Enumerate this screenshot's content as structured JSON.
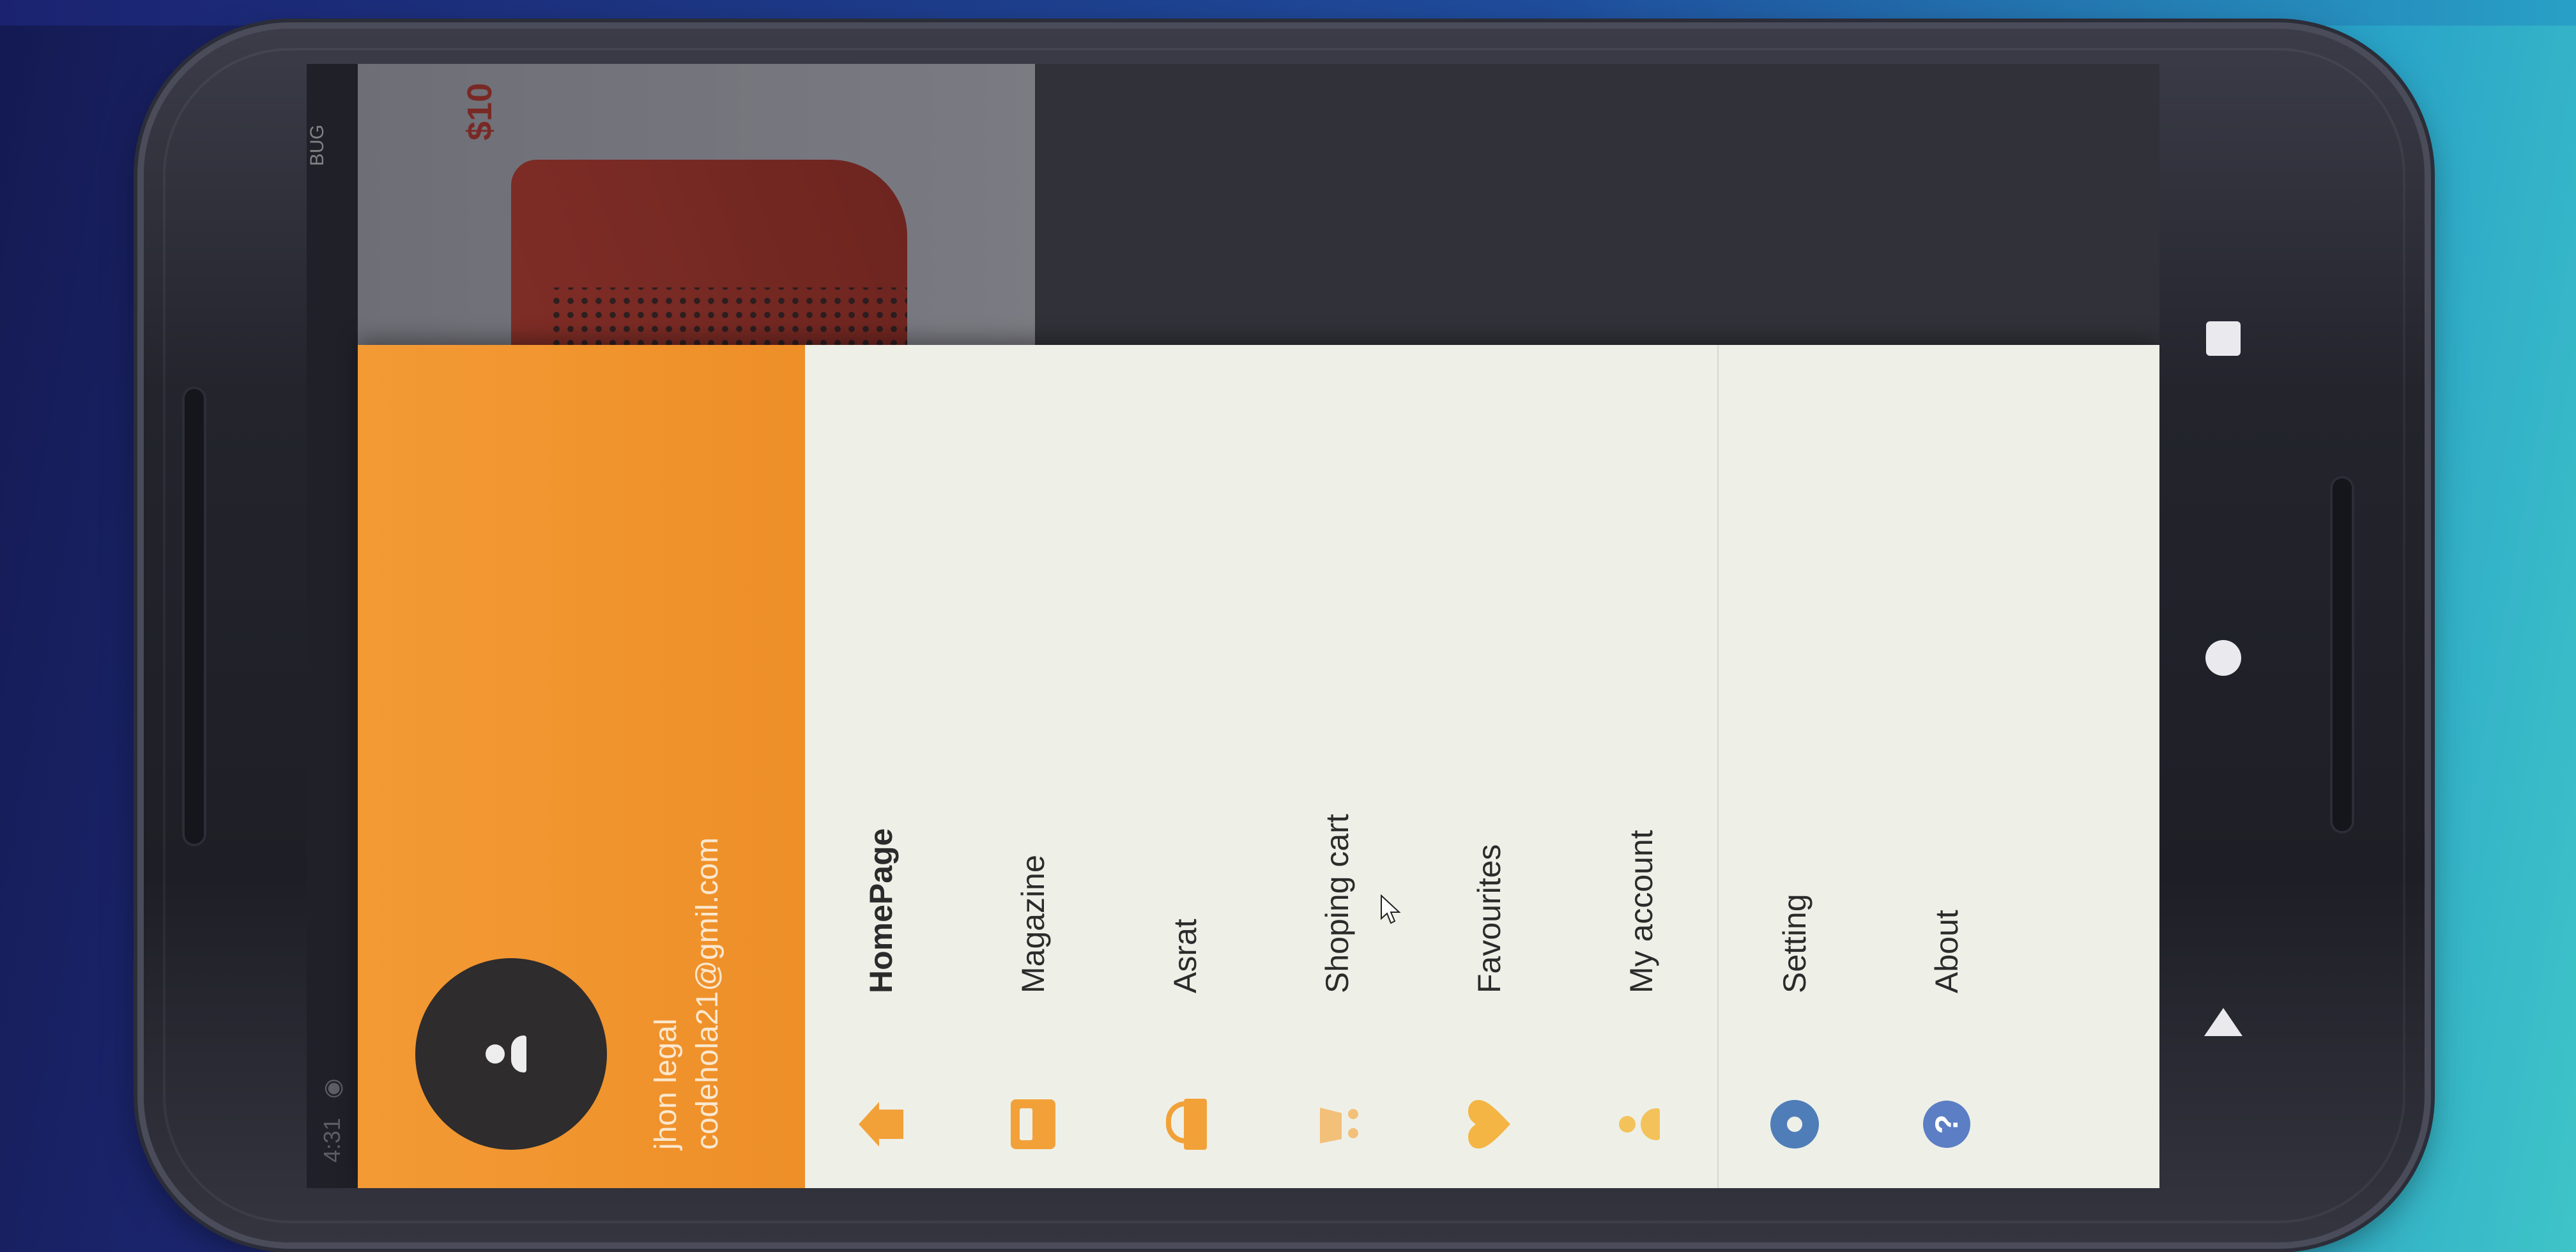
{
  "status_bar": {
    "time": "4:31"
  },
  "debug_badge": "BUG",
  "product": {
    "price": "$10"
  },
  "drawer": {
    "user_name": "jhon legal",
    "user_email": "codehola21@gmil.com",
    "items": [
      {
        "label": "HomePage",
        "icon": "home-icon",
        "active": true
      },
      {
        "label": "Magazine",
        "icon": "magazine-icon"
      },
      {
        "label": "Asrat",
        "icon": "basket-icon"
      },
      {
        "label": "Shoping cart",
        "icon": "shopping-cart-icon"
      },
      {
        "label": "Favourites",
        "icon": "heart-icon"
      },
      {
        "label": "My account",
        "icon": "person-icon"
      },
      {
        "label": "Setting",
        "icon": "gear-icon"
      },
      {
        "label": "About",
        "icon": "help-icon"
      }
    ]
  },
  "colors": {
    "header": "#f39a35",
    "drawer_bg": "#eef0e8",
    "icon_accent": "#f2a139",
    "settings_icon": "#4f7db8"
  }
}
